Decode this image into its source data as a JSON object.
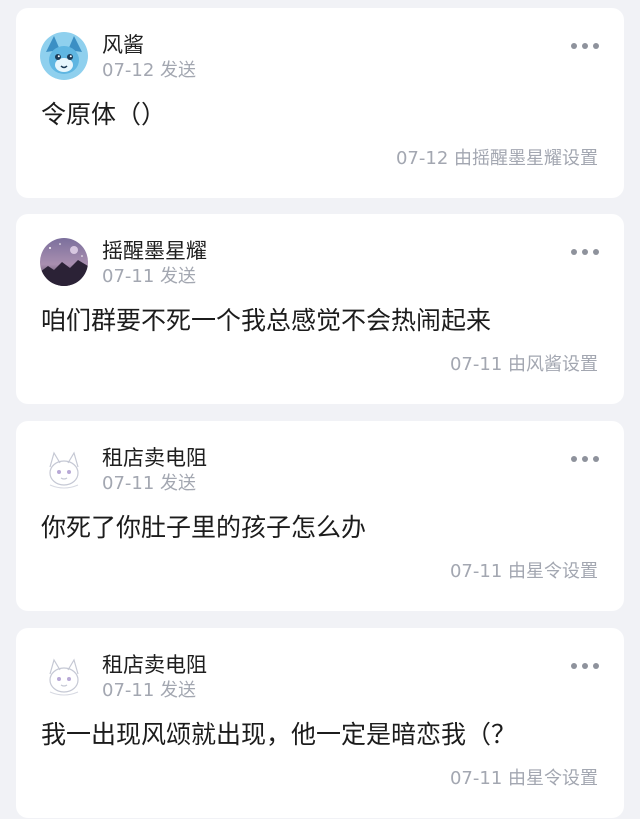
{
  "posts": [
    {
      "author": "风酱",
      "sent_date": "07-12",
      "sent_label": "发送",
      "message": "令原体（）",
      "set_by": "07-12 由摇醒墨星耀设置",
      "avatar_icon": "cartoon-fox-avatar-icon",
      "avatar_color": "#4fa8d8"
    },
    {
      "author": "摇醒墨星耀",
      "sent_date": "07-11",
      "sent_label": "发送",
      "message": "咱们群要不死一个我总感觉不会热闹起来",
      "set_by": "07-11 由风酱设置",
      "avatar_icon": "night-scene-avatar-icon",
      "avatar_color": "#5a4a6e"
    },
    {
      "author": "租店卖电阻",
      "sent_date": "07-11",
      "sent_label": "发送",
      "message": "你死了你肚子里的孩子怎么办",
      "set_by": "07-11 由星令设置",
      "avatar_icon": "sketch-character-avatar-icon",
      "avatar_color": "#d9dbe6"
    },
    {
      "author": "租店卖电阻",
      "sent_date": "07-11",
      "sent_label": "发送",
      "message": "我一出现风颂就出现，他一定是暗恋我（？",
      "set_by": "07-11 由星令设置",
      "avatar_icon": "sketch-character-avatar-icon",
      "avatar_color": "#d9dbe6"
    }
  ],
  "more_icon": "more-dots-icon"
}
